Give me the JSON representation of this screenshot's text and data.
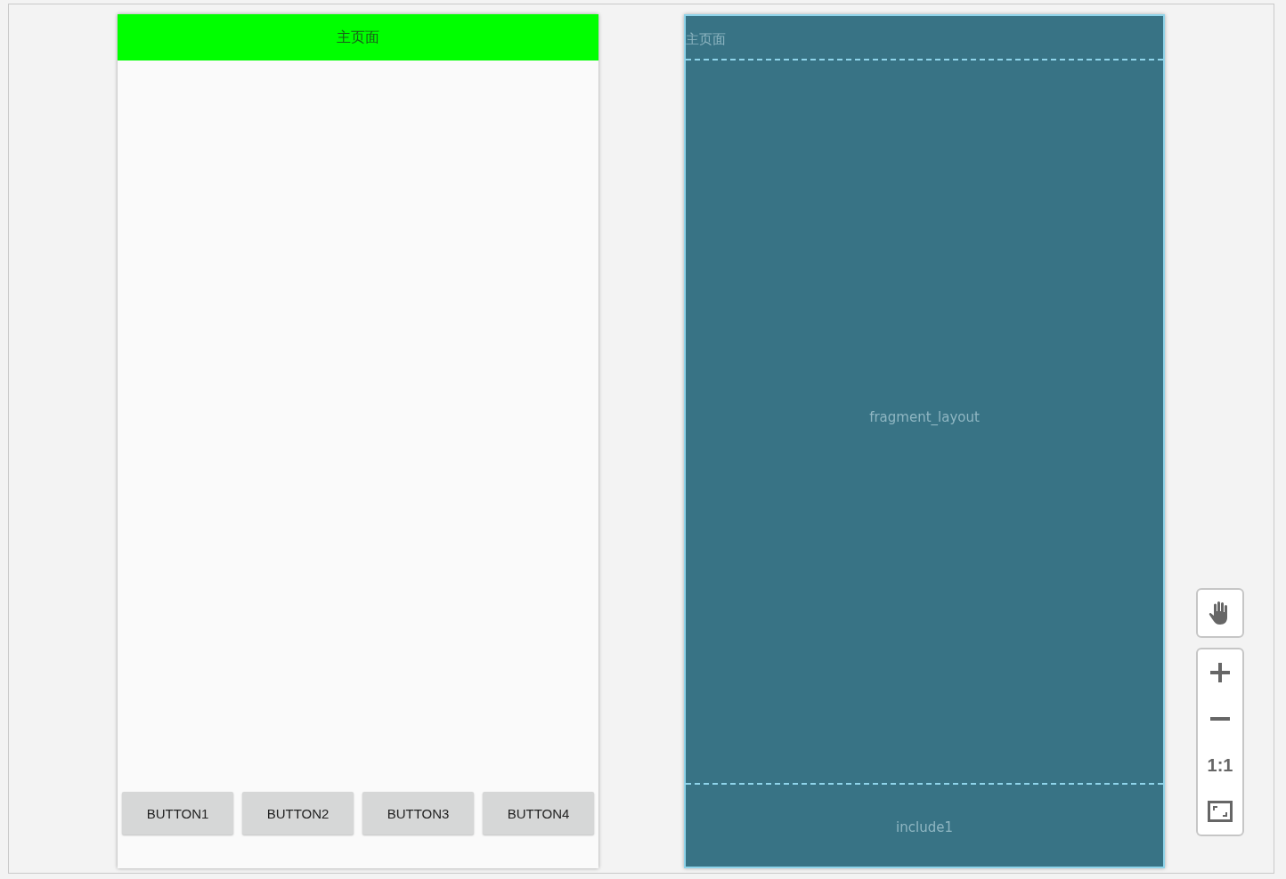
{
  "design_preview": {
    "title": "主页面",
    "buttons": [
      "BUTTON1",
      "BUTTON2",
      "BUTTON3",
      "BUTTON4"
    ]
  },
  "blueprint": {
    "title": "主页面",
    "fragment_label": "fragment_layout",
    "include_label": "include1"
  },
  "zoom_controls": {
    "actual_size_label": "1:1"
  }
}
